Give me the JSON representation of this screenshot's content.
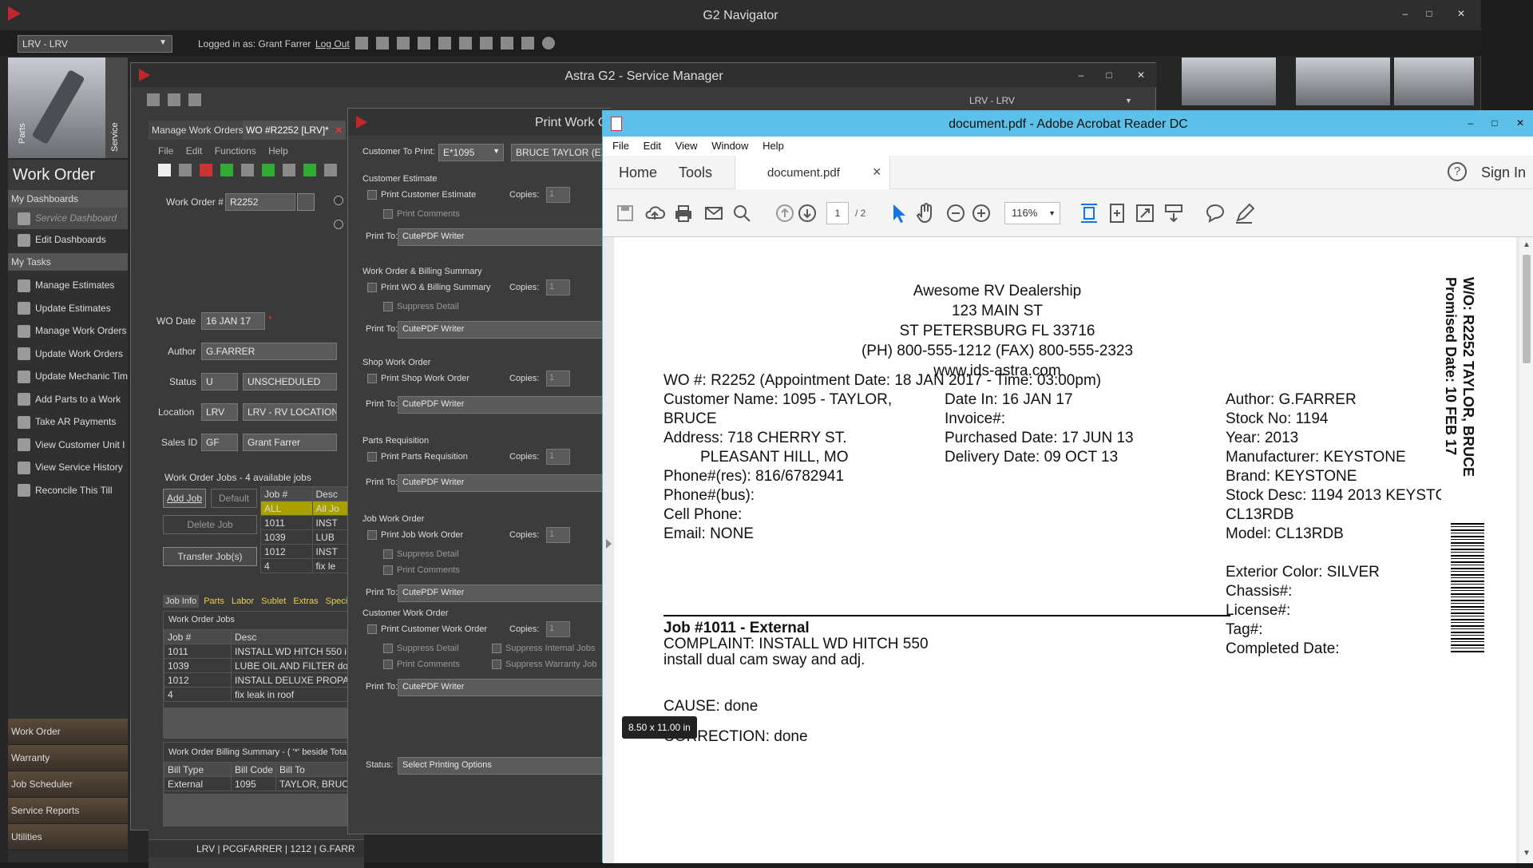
{
  "navigator": {
    "title": "G2 Navigator",
    "location": "LRV - LRV",
    "logged_in": "Logged in as: Grant Farrer",
    "logout": "Log Out",
    "win_min": "–",
    "win_max": "□",
    "win_close": "✕"
  },
  "sidebar": {
    "parts_tab": "Parts",
    "service_tab": "Service",
    "section_title": "Work Order",
    "my_dashboards": "My Dashboards",
    "dashboards": [
      "Service Dashboard",
      "Edit Dashboards"
    ],
    "my_tasks": "My Tasks",
    "tasks": [
      "Manage Estimates",
      "Update Estimates",
      "Manage Work Orders",
      "Update Work Orders",
      "Update Mechanic Tim",
      "Add Parts to a Work",
      "Take AR Payments",
      "View Customer Unit I",
      "View Service History",
      "Reconcile This Till"
    ],
    "bottom": [
      "Work Order",
      "Warranty",
      "Job Scheduler",
      "Service Reports",
      "Utilities"
    ]
  },
  "service_manager": {
    "title": "Astra G2 - Service Manager",
    "location": "LRV - LRV",
    "tab_manage": "Manage Work Orders",
    "tab_wo": "WO #R2252 [LRV]*",
    "tab_close": "✕",
    "menu": [
      "File",
      "Edit",
      "Functions",
      "Help"
    ],
    "wo_label": "Work Order #",
    "wo_value": "R2252",
    "date_label": "WO Date",
    "date_value": "16 JAN 17",
    "author_label": "Author",
    "author_value": "G.FARRER",
    "status_label": "Status",
    "status_code": "U",
    "status_value": "UNSCHEDULED",
    "location_label": "Location",
    "location_code": "LRV",
    "location_value": "LRV - RV LOCATION",
    "sales_label": "Sales ID",
    "sales_code": "GF",
    "sales_value": "Grant Farrer",
    "jobs_caption": "Work Order Jobs - 4 available jobs",
    "btn_add": "Add Job",
    "btn_default": "Default",
    "btn_delete": "Delete Job",
    "btn_transfer": "Transfer Job(s)",
    "jobs_cols": [
      "Job #",
      "Desc"
    ],
    "jobs_rows": [
      [
        "ALL",
        "All Jo"
      ],
      [
        "1011",
        "INST"
      ],
      [
        "1039",
        "LUB"
      ],
      [
        "1012",
        "INST"
      ],
      [
        "4",
        "fix le"
      ]
    ],
    "subtabs": [
      "Job Info",
      "Parts",
      "Labor",
      "Sublet",
      "Extras",
      "Specia"
    ],
    "wo_jobs_caption": "Work Order Jobs",
    "wo_jobs_cols": [
      "Job #",
      "Desc"
    ],
    "wo_jobs_rows": [
      [
        "1011",
        "INSTALL WD HITCH 550 i"
      ],
      [
        "1039",
        "LUBE OIL AND FILTER do"
      ],
      [
        "1012",
        "INSTALL DELUXE PROPA"
      ],
      [
        "4",
        "fix leak in roof"
      ]
    ],
    "billing_caption": "Work Order Billing Summary - ( '*' beside Tota",
    "billing_cols": [
      "Bill Type",
      "Bill Code",
      "Bill To"
    ],
    "billing_rows": [
      [
        "External",
        "1095",
        "TAYLOR, BRUC"
      ]
    ],
    "statusbar": "LRV | PCGFARRER | 1212 | G.FARR"
  },
  "print_wo": {
    "title": "Print Work O",
    "customer_label": "Customer To Print:",
    "customer_code": "E*1095",
    "customer_name": "BRUCE TAYLOR (EXT",
    "copies": "Copies:",
    "copies_val": "1",
    "print_to": "Print To:",
    "printer": "CutePDF Writer",
    "sections": [
      {
        "title": "Customer Estimate",
        "main": "Print Customer Estimate",
        "subs": [
          "Print Comments"
        ]
      },
      {
        "title": "Work Order & Billing Summary",
        "main": "Print WO & Billing Summary",
        "subs": [
          "Suppress Detail"
        ]
      },
      {
        "title": "Shop Work Order",
        "main": "Print Shop Work Order",
        "subs": []
      },
      {
        "title": "Parts Requisition",
        "main": "Print Parts Requisition",
        "subs": []
      },
      {
        "title": "Job Work Order",
        "main": "Print Job Work Order",
        "subs": [
          "Suppress Detail",
          "Print Comments"
        ]
      },
      {
        "title": "Customer Work Order",
        "main": "Print Customer Work Order",
        "subs": [
          "Suppress Detail",
          "Print Comments"
        ],
        "subs2": [
          "Suppress Internal Jobs",
          "Suppress Warranty Job"
        ]
      }
    ],
    "status_label": "Status:",
    "status_value": "Select Printing Options"
  },
  "acrobat": {
    "title": "document.pdf - Adobe Acrobat Reader DC",
    "menu": [
      "File",
      "Edit",
      "View",
      "Window",
      "Help"
    ],
    "nav_home": "Home",
    "nav_tools": "Tools",
    "doc_tab": "document.pdf",
    "tab_close": "×",
    "help_icon": "?",
    "sign_in": "Sign In",
    "page_current": "1",
    "page_total": "/ 2",
    "zoom": "116%",
    "page_size": "8.50 x 11.00 in"
  },
  "pdf": {
    "dealer": [
      "Awesome RV Dealership",
      "123 MAIN ST",
      "ST PETERSBURG FL 33716",
      "(PH) 800-555-1212 (FAX) 800-555-2323",
      "www.ids-astra.com"
    ],
    "wo_line": "WO #: R2252  (Appointment Date: 18 JAN 2017 - Time: 03:00pm)",
    "col1": [
      "Customer Name: 1095 - TAYLOR,",
      "BRUCE",
      "Address: 718 CHERRY ST.",
      "PLEASANT HILL, MO",
      "Phone#(res): 816/6782941",
      "Phone#(bus):",
      "Cell Phone:",
      "Email: NONE"
    ],
    "col2": [
      "Date In: 16 JAN 17",
      "Invoice#:",
      "Purchased Date: 17 JUN 13",
      "Delivery Date: 09 OCT 13"
    ],
    "col3": [
      "Author: G.FARRER",
      "Stock No: 1194",
      "Year: 2013",
      "Manufacturer: KEYSTONE",
      "Brand: KEYSTONE",
      "Stock Desc: 1194 2013 KEYSTC",
      "CL13RDB",
      "Model: CL13RDB"
    ],
    "col3b": [
      "Exterior Color: SILVER",
      "Chassis#:",
      "License#:",
      "Tag#:",
      "Completed Date:"
    ],
    "side1": "W/O: R2252   TAYLOR, BRUCE",
    "side2": "Promised Date: 10 FEB 17",
    "job_title": "Job #1011 - External",
    "complaint": "COMPLAINT: INSTALL WD HITCH 550",
    "note": "install dual cam sway and adj.",
    "cause": "CAUSE: done",
    "correction": "CORRECTION: done"
  }
}
